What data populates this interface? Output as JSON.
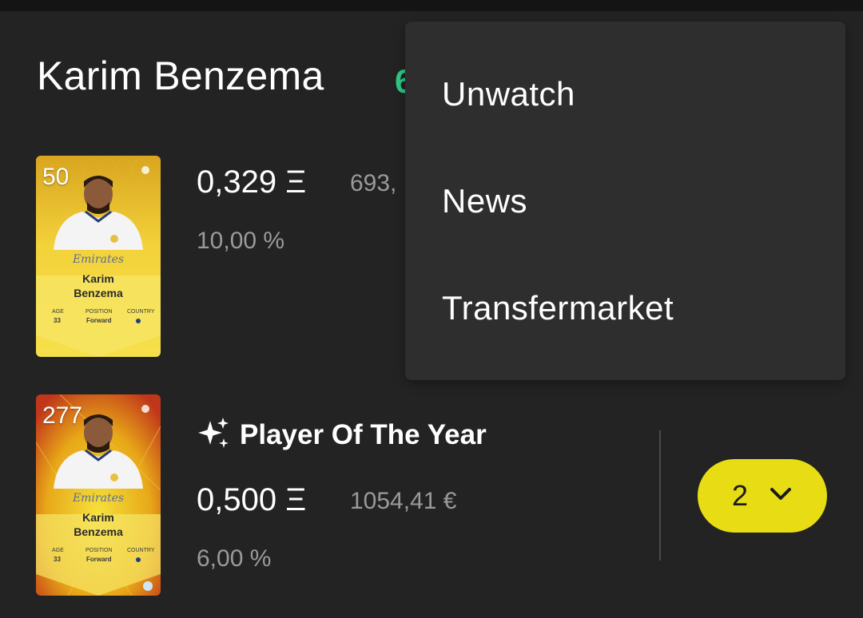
{
  "player": {
    "name": "Karim Benzema",
    "score_partial": "6"
  },
  "cards": [
    {
      "serial": "50",
      "first_name": "Karim",
      "last_name": "Benzema",
      "sponsor": "Emirates",
      "age_label": "AGE",
      "age": "33",
      "position_label": "POSITION",
      "position": "Forward",
      "country_label": "COUNTRY",
      "price": "0,329 Ξ",
      "fiat": "693,",
      "percent": "10,00 %"
    },
    {
      "serial": "277",
      "first_name": "Karim",
      "last_name": "Benzema",
      "sponsor": "Emirates",
      "age_label": "AGE",
      "age": "33",
      "position_label": "POSITION",
      "position": "Forward",
      "country_label": "COUNTRY",
      "price": "0,500 Ξ",
      "fiat": "1054,41 €",
      "percent": "6,00 %",
      "rarity_icon": "sparkle-icon",
      "rarity_label": "Player Of The Year"
    }
  ],
  "quantity": {
    "value": "2",
    "icon": "chevron-down-icon"
  },
  "menu": {
    "items": [
      "Unwatch",
      "News",
      "Transfermarket"
    ]
  },
  "colors": {
    "background": "#232323",
    "menu_bg": "#2e2e2e",
    "accent_green": "#2ecc87",
    "pill_yellow": "#e8dc14",
    "muted_text": "#9a9a9a"
  }
}
